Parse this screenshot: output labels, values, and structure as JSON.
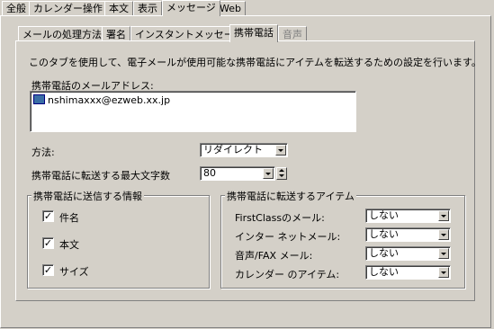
{
  "outer_tabs": [
    "全般",
    "カレンダー操作",
    "本文",
    "表示",
    "メッセージ",
    "Web"
  ],
  "outer_active": "メッセージ",
  "inner_tabs": [
    "メールの処理方法",
    "署名",
    "インスタントメッセージ",
    "携帯電話",
    "音声"
  ],
  "inner_active": "携帯電話",
  "description": "このタブを使用して、電子メールが使用可能な携帯電話にアイテムを転送するための設定を行います。",
  "email_section": {
    "label": "携帯電話のメールアドレス:",
    "entries": [
      "nshimaxxx@ezweb.xx.jp"
    ]
  },
  "method": {
    "label": "方法:",
    "value": "リダイレクト"
  },
  "max_chars": {
    "label": "携帯電話に転送する最大文字数",
    "value": "80"
  },
  "info_group": {
    "title": "携帯電話に送信する情報",
    "items": [
      {
        "label": "件名",
        "checked": "✓"
      },
      {
        "label": "本文",
        "checked": "✓"
      },
      {
        "label": "サイズ",
        "checked": "✓"
      }
    ]
  },
  "items_group": {
    "title": "携帯電話に転送するアイテム",
    "rows": [
      {
        "label": "FirstClassのメール:",
        "value": "しない"
      },
      {
        "label": "インター ネットメール:",
        "value": "しない"
      },
      {
        "label": "音声/FAX メール:",
        "value": "しない"
      },
      {
        "label": "カレンダー のアイテム:",
        "value": "しない"
      }
    ]
  }
}
